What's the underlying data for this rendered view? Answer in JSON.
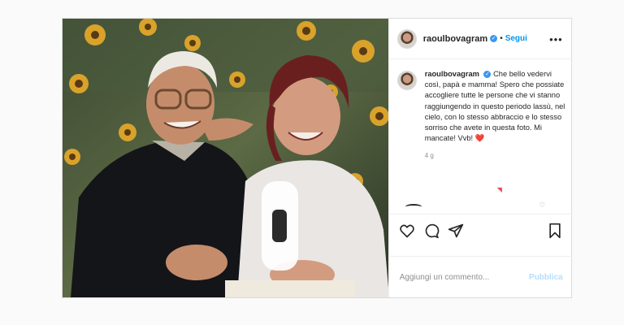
{
  "post": {
    "username": "raoulbovagram",
    "follow_label": "Segui",
    "separator": "•",
    "more_label": "•••",
    "caption_text": "Che bello vedervi così, papà e mamma! Spero che possiate accogliere tutte le persone che vi stanno raggiungendo in questo periodo lassù, nel cielo, con lo stesso abbraccio e lo stesso sorriso che avete in questa foto. Mi mancate! Vvb!",
    "caption_emoji": "❤️",
    "age": "4 g",
    "comment_placeholder": "Aggiungi un commento...",
    "publish_label": "Pubblica"
  },
  "icons": {
    "like": "heart-outline-icon",
    "comment": "comment-bubble-icon",
    "share": "paper-plane-icon",
    "save": "bookmark-icon",
    "more": "ellipsis-icon",
    "verified": "verified-badge-icon"
  },
  "colors": {
    "accent": "#0095f6",
    "verified": "#3897f0",
    "like_red": "#ed4956",
    "publish_disabled": "#b2dffc"
  }
}
